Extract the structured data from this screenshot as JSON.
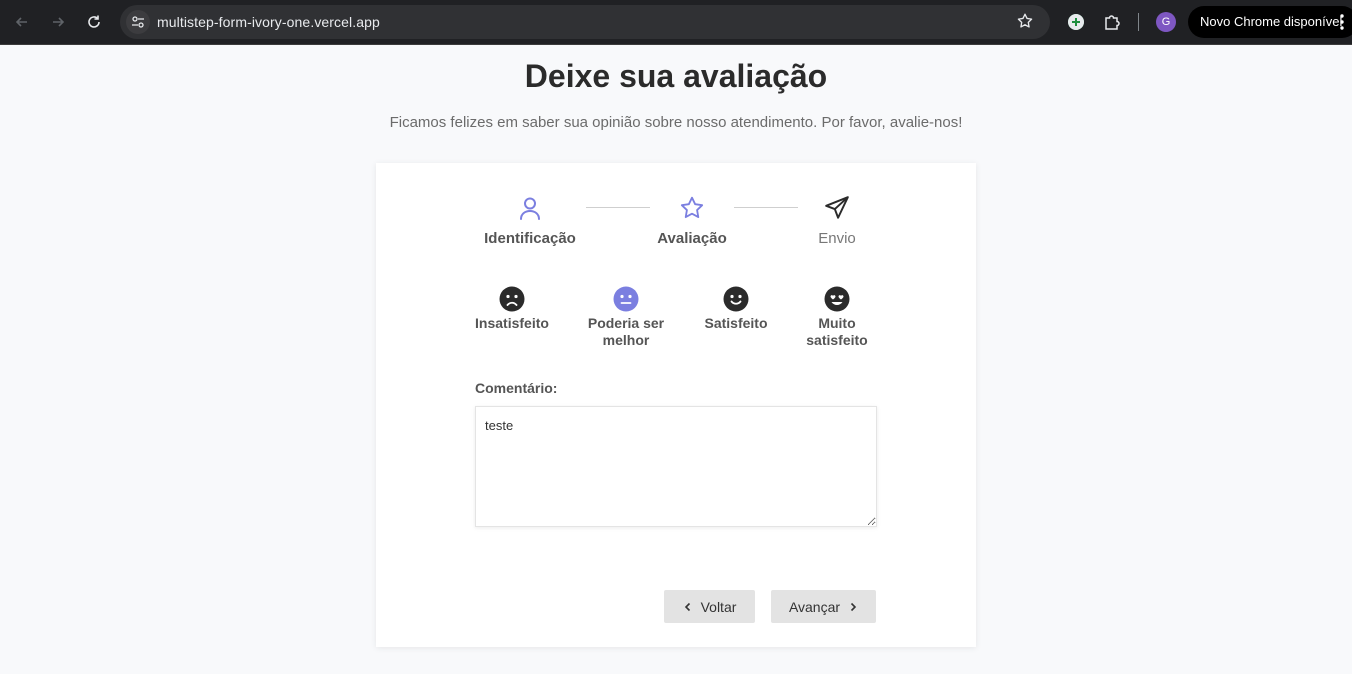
{
  "browser": {
    "url": "multistep-form-ivory-one.vercel.app",
    "profile_initial": "G",
    "update_label": "Novo Chrome disponível"
  },
  "page": {
    "title": "Deixe sua avaliação",
    "subtitle": "Ficamos felizes em saber sua opinião sobre nosso atendimento. Por favor, avalie-nos!"
  },
  "steps": [
    {
      "label": "Identificação",
      "icon": "user-icon",
      "state": "done"
    },
    {
      "label": "Avaliação",
      "icon": "star-icon",
      "state": "active"
    },
    {
      "label": "Envio",
      "icon": "send-icon",
      "state": "pending"
    }
  ],
  "ratings": [
    {
      "label": "Insatisfeito",
      "icon": "frown-icon",
      "selected": false
    },
    {
      "label": "Poderia ser melhor",
      "icon": "neutral-face-icon",
      "selected": true
    },
    {
      "label": "Satisfeito",
      "icon": "smile-icon",
      "selected": false
    },
    {
      "label": "Muito satisfeito",
      "icon": "heart-eyes-icon",
      "selected": false
    }
  ],
  "comment": {
    "label": "Comentário:",
    "value": "teste"
  },
  "buttons": {
    "back_label": "Voltar",
    "next_label": "Avançar"
  },
  "colors": {
    "accent": "#7b7fe0",
    "dark": "#2b2b2b",
    "button_bg": "#e3e3e3"
  }
}
